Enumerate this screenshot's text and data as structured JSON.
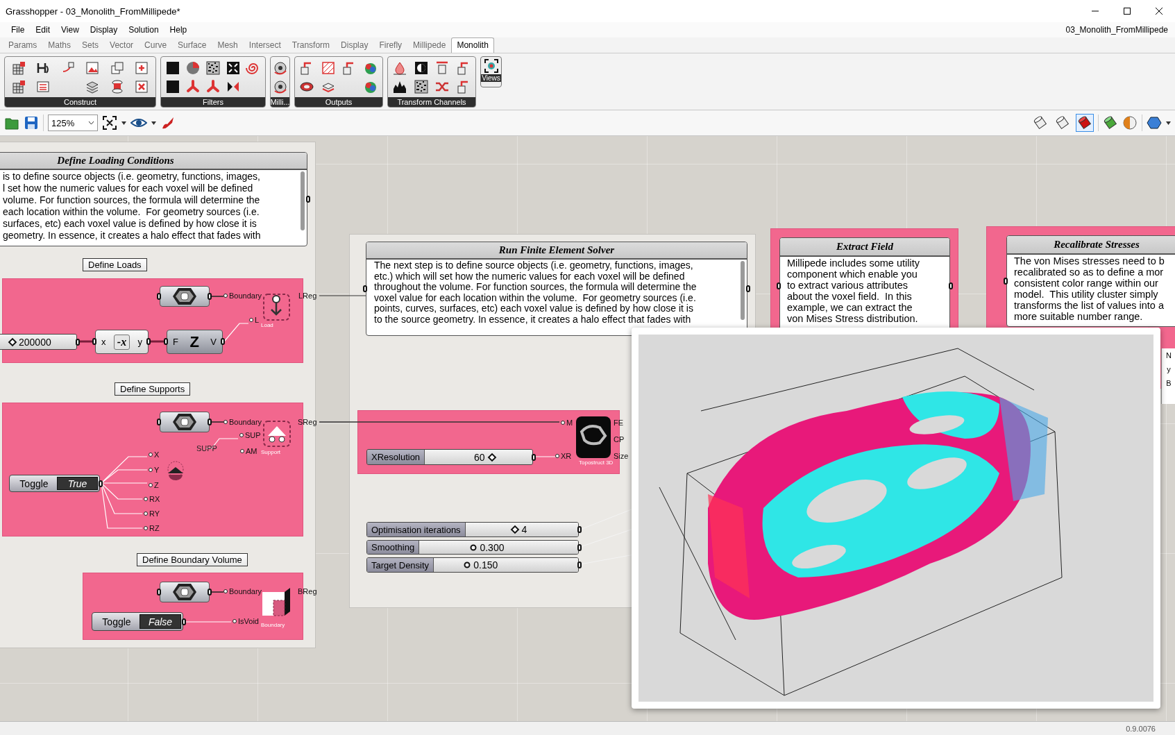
{
  "window": {
    "title": "Grasshopper - 03_Monolith_FromMillipede*",
    "document": "03_Monolith_FromMillipede"
  },
  "menu": [
    "File",
    "Edit",
    "View",
    "Display",
    "Solution",
    "Help"
  ],
  "tabs": [
    {
      "label": "Params",
      "selected": false
    },
    {
      "label": "Maths",
      "selected": false
    },
    {
      "label": "Sets",
      "selected": false
    },
    {
      "label": "Vector",
      "selected": false
    },
    {
      "label": "Curve",
      "selected": false
    },
    {
      "label": "Surface",
      "selected": false
    },
    {
      "label": "Mesh",
      "selected": false
    },
    {
      "label": "Intersect",
      "selected": false
    },
    {
      "label": "Transform",
      "selected": false
    },
    {
      "label": "Display",
      "selected": false
    },
    {
      "label": "Firefly",
      "selected": false
    },
    {
      "label": "Millipede",
      "selected": false
    },
    {
      "label": "Monolith",
      "selected": true
    }
  ],
  "ribbon": {
    "groups": [
      "Construct",
      "Filters",
      "Milli...",
      "Outputs",
      "Transform Channels"
    ],
    "views": "Views"
  },
  "toolbar": {
    "zoom": "125%",
    "preview_modes": [
      {
        "selected": false
      },
      {
        "selected": false
      },
      {
        "selected": true
      }
    ]
  },
  "panels": [
    {
      "title": "Define Loading Conditions",
      "text": "is to define source objects (i.e. geometry, functions, images,\nl set how the numeric values for each voxel will be defined\nvolume. For function sources, the formula will determine the\neach location within the volume.  For geometry sources (i.e.\nsurfaces, etc) each voxel value is defined by how close it is\ngeometry. In essence, it creates a halo effect that fades with"
    },
    {
      "title": "Run Finite Element Solver",
      "text": "The next step is to define source objects (i.e. geometry, functions, images,\netc.) which will set how the numeric values for each voxel will be defined\nthroughout the volume. For function sources, the formula will determine the\nvoxel value for each location within the volume.  For geometry sources (i.e.\npoints, curves, surfaces, etc) each voxel value is defined by how close it is\nto the source geometry. In essence, it creates a halo effect that fades with"
    },
    {
      "title": "Extract Field",
      "text": "Millipede includes some utility\ncomponent which enable you\nto extract various attributes\nabout the voxel field.  In this\nexample, we can extract the\nvon Mises Stress distribution."
    },
    {
      "title": "Recalibrate Stresses",
      "text": "The von Mises stresses need to b\nrecalibrated so as to define a mor\nconsistent color range within our\nmodel.  This utility cluster simply\ntransforms the list of values into a\nmore suitable number range."
    }
  ],
  "callouts": [
    "Define Loads",
    "Define Supports",
    "Define Boundary Volume"
  ],
  "sliders": [
    {
      "kind": "integer",
      "value": "200000"
    },
    {
      "kind": "integer",
      "label": "XResolution",
      "value": "60",
      "level": 0.65
    },
    {
      "kind": "integer",
      "label": "Optimisation iterations",
      "value": "4",
      "level": 0.43
    },
    {
      "kind": "float",
      "label": "Smoothing",
      "value": "0.300",
      "level": 0.32
    },
    {
      "kind": "float",
      "label": "Target Density",
      "value": "0.150",
      "level": 0.19
    }
  ],
  "toggles": [
    {
      "label": "Toggle",
      "value": "True"
    },
    {
      "label": "Toggle",
      "value": "False"
    }
  ],
  "components": [
    {
      "kind": "negative",
      "inputs": [
        "x"
      ],
      "glyph": "-x",
      "outputs": [
        "y"
      ]
    },
    {
      "kind": "vector",
      "inputs": [
        "F"
      ],
      "glyph": "Z",
      "outputs": [
        "V"
      ]
    },
    {
      "kind": "topostruct",
      "inputs": [
        "M",
        "XR"
      ],
      "caption": "Topostruct 3D",
      "outputs": [
        "FE",
        "CP",
        "Size"
      ]
    }
  ],
  "clusters": [
    {
      "kind": "load",
      "inputs": [
        "Boundary",
        "L"
      ],
      "caption": "Load",
      "outputs": [
        "LReg"
      ]
    },
    {
      "kind": "support",
      "inputs": [
        "Boundary",
        "SUP",
        "AM"
      ],
      "caption": "Support",
      "outputs": [
        "SReg"
      ]
    },
    {
      "kind": "boundary",
      "inputs": [
        "Boundary",
        "IsVoid"
      ],
      "caption": "Boundary",
      "outputs": [
        "BReg"
      ]
    }
  ],
  "support_dof": {
    "inputs": [
      "X",
      "Y",
      "Z",
      "RX",
      "RY",
      "RZ"
    ],
    "outputs": [
      "SUPP"
    ]
  },
  "edge_labels": [
    "N",
    "y",
    "B"
  ],
  "status_bar": {
    "version": "0.9.0076"
  }
}
